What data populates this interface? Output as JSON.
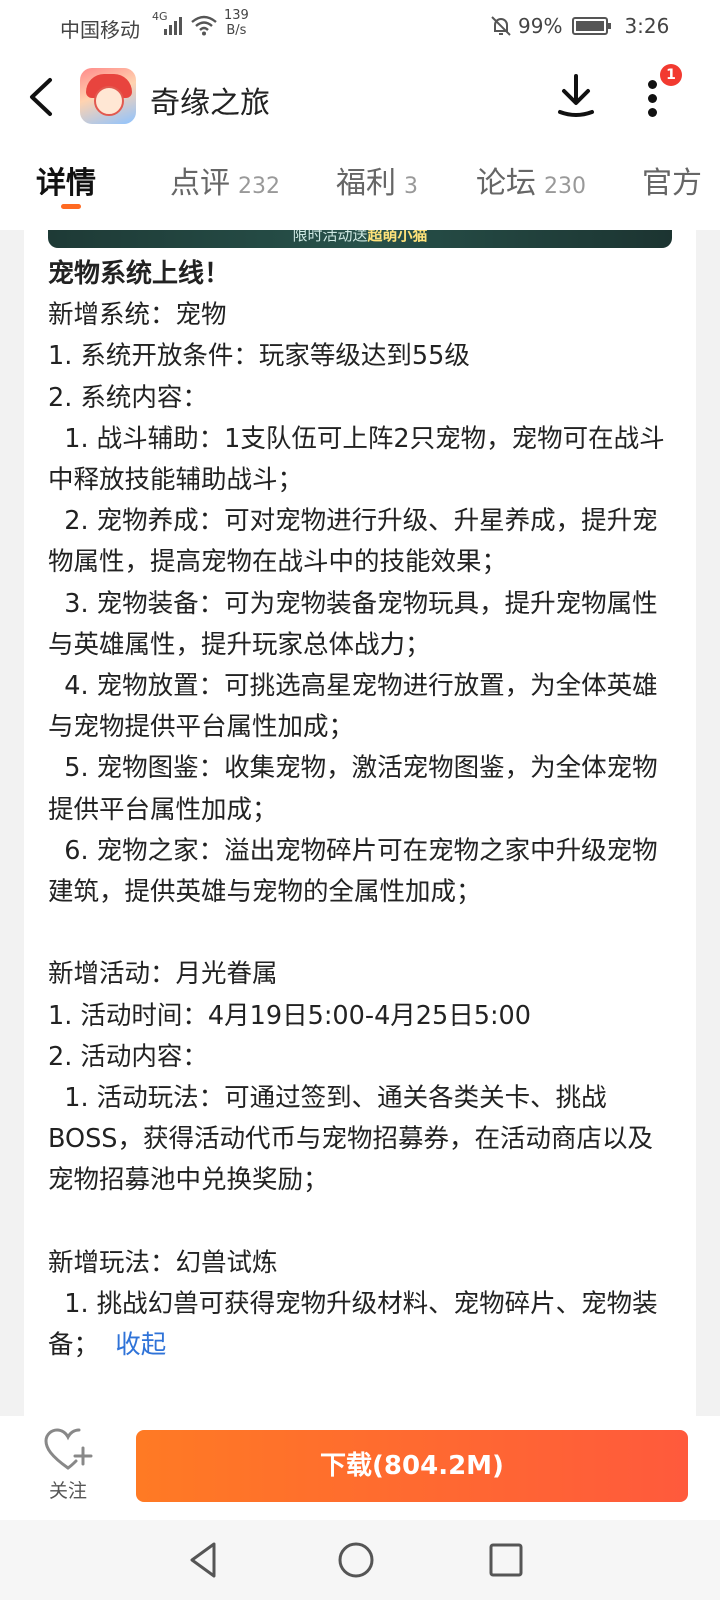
{
  "status_bar": {
    "carrier": "中国移动",
    "network": "4G",
    "speed_value": "139",
    "speed_unit": "B/s",
    "battery": "99%",
    "time": "3:26",
    "icons": [
      "signal-icon",
      "wifi-icon",
      "bell-off-icon",
      "battery-icon"
    ]
  },
  "header": {
    "app_name": "奇缘之旅",
    "notification_badge": "1",
    "icons": [
      "back-arrow-icon",
      "download-icon",
      "more-vertical-icon"
    ]
  },
  "tabs": [
    {
      "label": "详情",
      "count": "",
      "active": true
    },
    {
      "label": "点评",
      "count": "232",
      "active": false
    },
    {
      "label": "福利",
      "count": "3",
      "active": false
    },
    {
      "label": "论坛",
      "count": "230",
      "active": false
    },
    {
      "label": "官方",
      "count": "",
      "active": false
    }
  ],
  "banner": {
    "text_prefix": "限时活动送",
    "text_highlight": "超萌小猫"
  },
  "article": {
    "heading": "宠物系统上线！",
    "lines": [
      "新增系统：宠物",
      "1. 系统开放条件：玩家等级达到55级",
      "2. 系统内容：",
      "  1. 战斗辅助：1支队伍可上阵2只宠物，宠物可在战斗中释放技能辅助战斗；",
      "  2. 宠物养成：可对宠物进行升级、升星养成，提升宠物属性，提高宠物在战斗中的技能效果；",
      "  3. 宠物装备：可为宠物装备宠物玩具，提升宠物属性与英雄属性，提升玩家总体战力；",
      "  4. 宠物放置：可挑选高星宠物进行放置，为全体英雄与宠物提供平台属性加成；",
      "  5. 宠物图鉴：收集宠物，激活宠物图鉴，为全体宠物提供平台属性加成；",
      "  6. 宠物之家：溢出宠物碎片可在宠物之家中升级宠物建筑，提供英雄与宠物的全属性加成；",
      "",
      "新增活动：月光眷属",
      "1. 活动时间：4月19日5:00-4月25日5:00",
      "2. 活动内容：",
      "  1. 活动玩法：可通过签到、通关各类关卡、挑战BOSS，获得活动代币与宠物招募券，在活动商店以及宠物招募池中兑换奖励；",
      "",
      "新增玩法：幻兽试炼",
      "  1. 挑战幻兽可获得宠物升级材料、宠物碎片、宠物装备；"
    ],
    "collapse_label": "收起"
  },
  "action_bar": {
    "follow_label": "关注",
    "download_label": "下载(804.2M)",
    "colors": {
      "download_start": "#ff7a24",
      "download_end": "#ff5a3c"
    }
  },
  "nav_bar": {
    "icons": [
      "nav-back-icon",
      "nav-home-icon",
      "nav-recents-icon"
    ]
  },
  "colors": {
    "accent": "#ff6a22",
    "link": "#2f73d8",
    "badge": "#f23a30"
  }
}
